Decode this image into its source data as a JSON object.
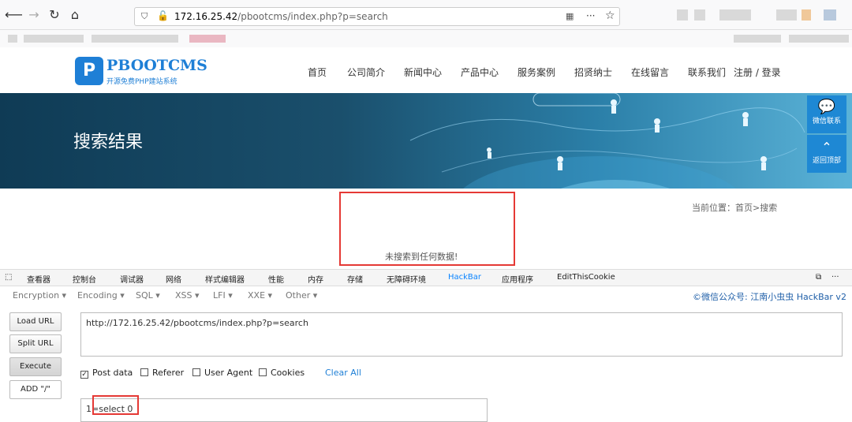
{
  "browser": {
    "url_host": "172.16.25.42",
    "url_path": "/pbootcms/index.php?p=search",
    "menu_glyph": "···",
    "star_glyph": "☆"
  },
  "site": {
    "logo_mark": "P",
    "logo_name": "PBOOTCMS",
    "logo_tagline": "开源免费PHP建站系统",
    "nav": [
      "首页",
      "公司简介",
      "新闻中心",
      "产品中心",
      "服务案例",
      "招贤纳士",
      "在线留言",
      "联系我们"
    ],
    "login": "注册 / 登录",
    "banner_title": "搜索结果",
    "side_wechat": "微信联系",
    "side_top": "返回顶部",
    "breadcrumb": "当前位置：首页>搜索",
    "no_result": "未搜索到任何数据!"
  },
  "devtools": {
    "tabs": [
      "查看器",
      "控制台",
      "调试器",
      "网络",
      "样式编辑器",
      "性能",
      "内存",
      "存储",
      "无障碍环境",
      "HackBar",
      "应用程序",
      "EditThisCookie"
    ],
    "active_tab": "HackBar"
  },
  "hackbar": {
    "menus": [
      "Encoding ▾",
      "Encoding ▾",
      "SQL ▾",
      "XSS ▾",
      "LFI ▾",
      "XXE ▾",
      "Other ▾"
    ],
    "menu_first": "Encryption ▾",
    "credit": "©微信公众号: 江南小虫虫 HackBar v2",
    "load_url": "Load URL",
    "split_url": "Split URL",
    "execute": "Execute",
    "add": "ADD \"/\"",
    "url_value": "http://172.16.25.42/pbootcms/index.php?p=search",
    "post_data": "Post data",
    "referer": "Referer",
    "user_agent": "User Agent",
    "cookies": "Cookies",
    "clear_all": "Clear All",
    "post_value": "1=select 0"
  },
  "colors": {
    "accent": "#1e7fd6",
    "highlight": "#e53935",
    "banner": "#1a4f6c"
  }
}
